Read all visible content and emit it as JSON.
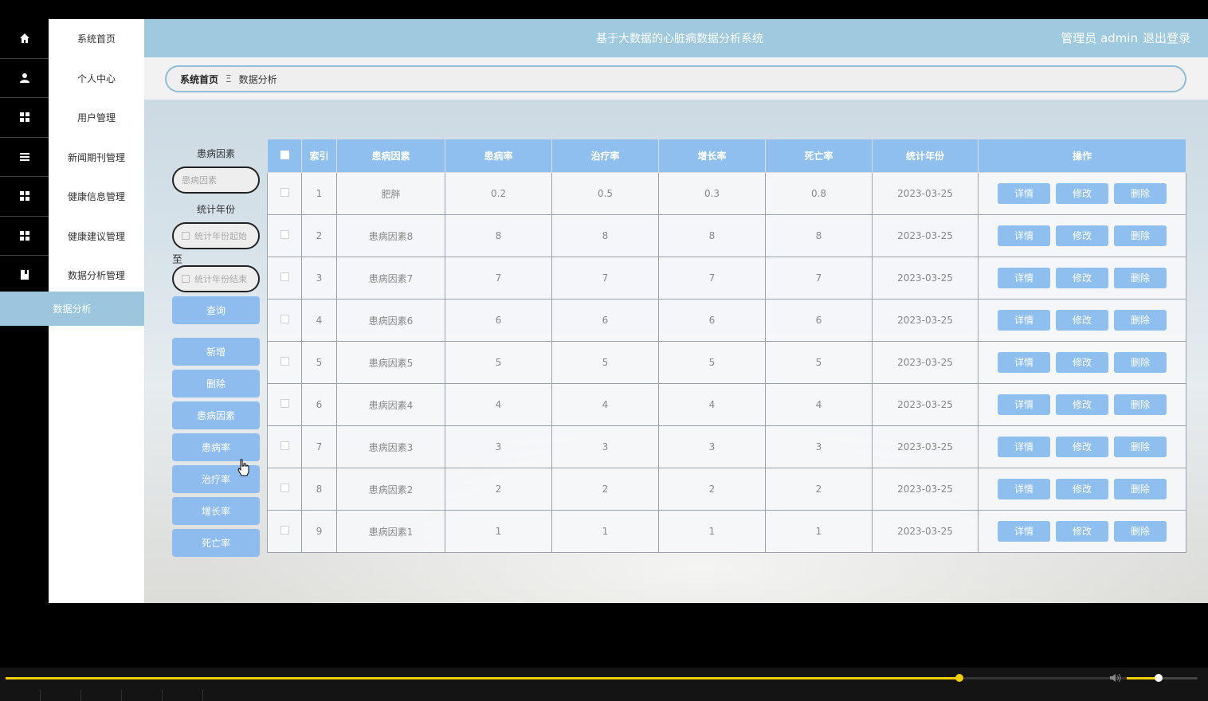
{
  "header": {
    "title": "基于大数据的心脏病数据分析系统",
    "user": "管理员 admin",
    "logout": "退出登录"
  },
  "sidebar": {
    "items": [
      {
        "label": "系统首页",
        "icon": "home-icon"
      },
      {
        "label": "个人中心",
        "icon": "user-icon"
      },
      {
        "label": "用户管理",
        "icon": "grid-icon"
      },
      {
        "label": "新闻期刊管理",
        "icon": "menu-icon"
      },
      {
        "label": "健康信息管理",
        "icon": "grid-icon"
      },
      {
        "label": "健康建议管理",
        "icon": "grid-icon"
      },
      {
        "label": "数据分析管理",
        "icon": "book-icon"
      }
    ],
    "active_sub": "数据分析"
  },
  "breadcrumb": {
    "home": "系统首页",
    "separator": "Ξ",
    "current": "数据分析"
  },
  "filter": {
    "factor_label": "患病因素",
    "factor_placeholder": "患病因素",
    "year_label": "统计年份",
    "year_start_placeholder": "统计年份起始",
    "to_label": "至",
    "year_end_placeholder": "统计年份结束",
    "query": "查询"
  },
  "actions": [
    "新增",
    "删除",
    "患病因素",
    "患病率",
    "治疗率",
    "增长率",
    "死亡率"
  ],
  "table": {
    "columns": [
      "索引",
      "患病因素",
      "患病率",
      "治疗率",
      "增长率",
      "死亡率",
      "统计年份",
      "操作"
    ],
    "row_buttons": [
      "详情",
      "修改",
      "删除"
    ],
    "rows": [
      [
        "1",
        "肥胖",
        "0.2",
        "0.5",
        "0.3",
        "0.8",
        "2023-03-25"
      ],
      [
        "2",
        "患病因素8",
        "8",
        "8",
        "8",
        "8",
        "2023-03-25"
      ],
      [
        "3",
        "患病因素7",
        "7",
        "7",
        "7",
        "7",
        "2023-03-25"
      ],
      [
        "4",
        "患病因素6",
        "6",
        "6",
        "6",
        "6",
        "2023-03-25"
      ],
      [
        "5",
        "患病因素5",
        "5",
        "5",
        "5",
        "5",
        "2023-03-25"
      ],
      [
        "6",
        "患病因素4",
        "4",
        "4",
        "4",
        "4",
        "2023-03-25"
      ],
      [
        "7",
        "患病因素3",
        "3",
        "3",
        "3",
        "3",
        "2023-03-25"
      ],
      [
        "8",
        "患病因素2",
        "2",
        "2",
        "2",
        "2",
        "2023-03-25"
      ],
      [
        "9",
        "患病因素1",
        "1",
        "1",
        "1",
        "1",
        "2023-03-25"
      ]
    ]
  },
  "player": {
    "progress": 0.8,
    "volume": 0.45,
    "accent": "#f4cf00"
  }
}
